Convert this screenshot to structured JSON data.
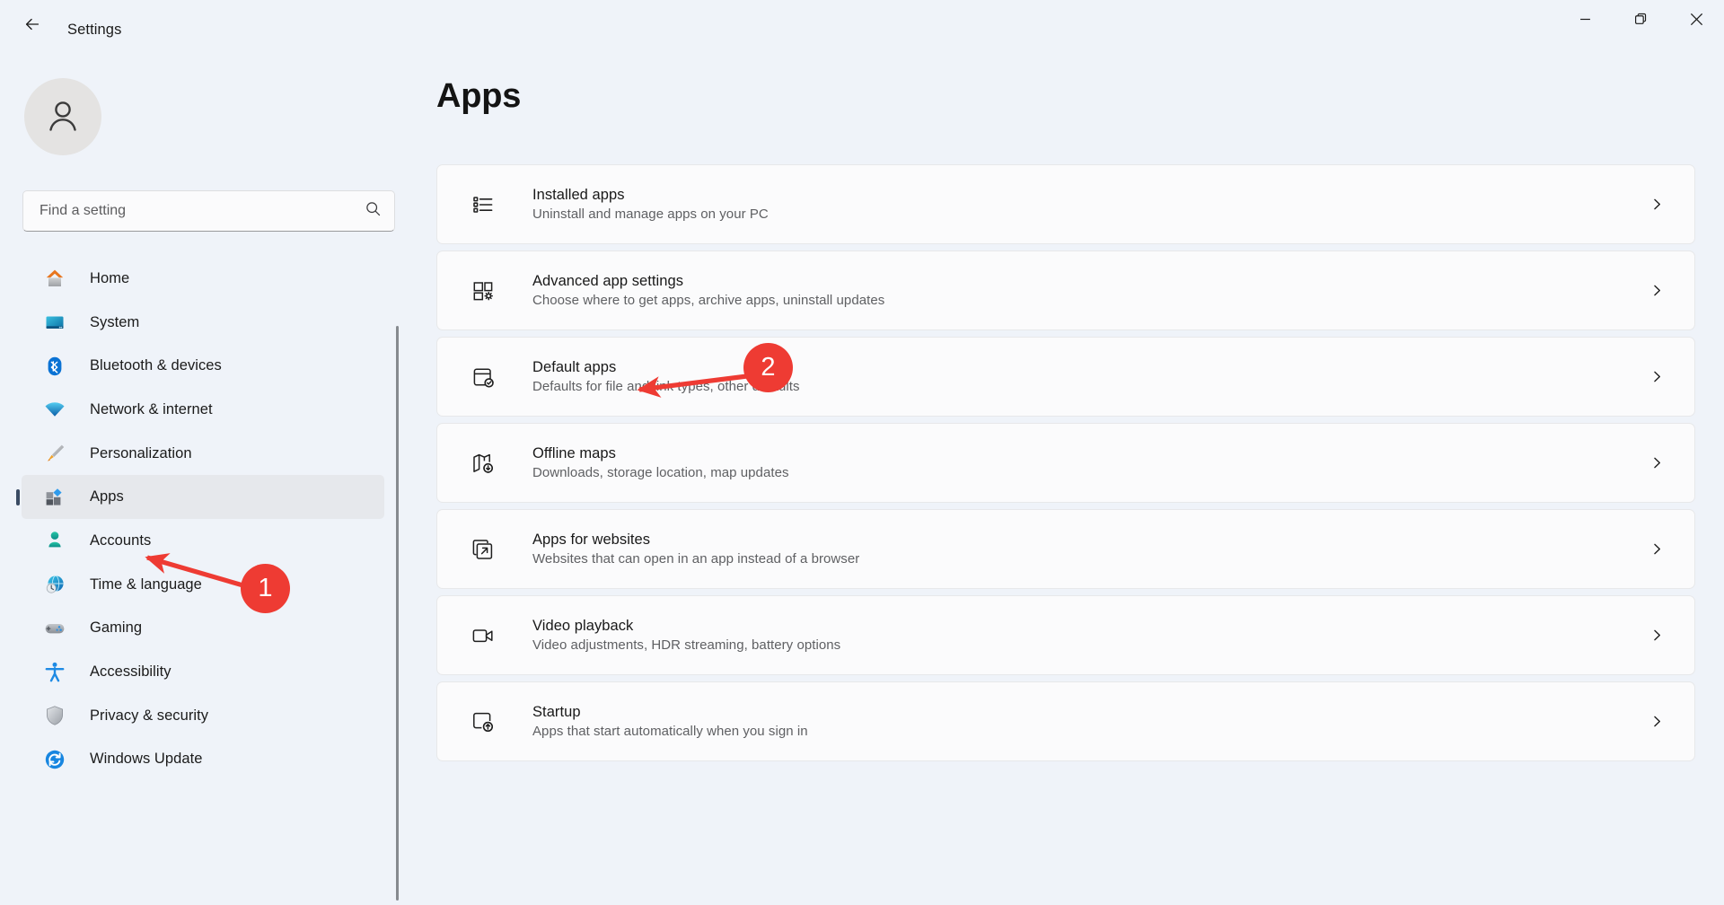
{
  "window": {
    "title": "Settings",
    "back_icon": "arrow-left-icon",
    "controls": [
      {
        "name": "minimize-button",
        "icon": "minimize-icon"
      },
      {
        "name": "maximize-button",
        "icon": "restore-icon"
      },
      {
        "name": "close-button",
        "icon": "close-icon"
      }
    ]
  },
  "sidebar": {
    "avatar_icon": "user-avatar-icon",
    "search": {
      "placeholder": "Find a setting",
      "value": "",
      "icon": "search-icon"
    },
    "items": [
      {
        "label": "Home",
        "icon": "home-icon",
        "selected": false
      },
      {
        "label": "System",
        "icon": "system-icon",
        "selected": false
      },
      {
        "label": "Bluetooth & devices",
        "icon": "bluetooth-icon",
        "selected": false
      },
      {
        "label": "Network & internet",
        "icon": "network-icon",
        "selected": false
      },
      {
        "label": "Personalization",
        "icon": "personalization-icon",
        "selected": false
      },
      {
        "label": "Apps",
        "icon": "apps-icon",
        "selected": true
      },
      {
        "label": "Accounts",
        "icon": "accounts-icon",
        "selected": false
      },
      {
        "label": "Time & language",
        "icon": "time-language-icon",
        "selected": false
      },
      {
        "label": "Gaming",
        "icon": "gaming-icon",
        "selected": false
      },
      {
        "label": "Accessibility",
        "icon": "accessibility-icon",
        "selected": false
      },
      {
        "label": "Privacy & security",
        "icon": "privacy-security-icon",
        "selected": false
      },
      {
        "label": "Windows Update",
        "icon": "windows-update-icon",
        "selected": false
      }
    ]
  },
  "main": {
    "title": "Apps",
    "cards": [
      {
        "title": "Installed apps",
        "subtitle": "Uninstall and manage apps on your PC",
        "icon": "installed-apps-icon"
      },
      {
        "title": "Advanced app settings",
        "subtitle": "Choose where to get apps, archive apps, uninstall updates",
        "icon": "advanced-app-settings-icon"
      },
      {
        "title": "Default apps",
        "subtitle": "Defaults for file and link types, other defaults",
        "icon": "default-apps-icon"
      },
      {
        "title": "Offline maps",
        "subtitle": "Downloads, storage location, map updates",
        "icon": "offline-maps-icon"
      },
      {
        "title": "Apps for websites",
        "subtitle": "Websites that can open in an app instead of a browser",
        "icon": "apps-for-websites-icon"
      },
      {
        "title": "Video playback",
        "subtitle": "Video adjustments, HDR streaming, battery options",
        "icon": "video-playback-icon"
      },
      {
        "title": "Startup",
        "subtitle": "Apps that start automatically when you sign in",
        "icon": "startup-icon"
      }
    ]
  },
  "annotations": {
    "color": "#ee3b33",
    "markers": [
      {
        "label": "1",
        "target": "sidebar-item-apps"
      },
      {
        "label": "2",
        "target": "card-default-apps"
      }
    ]
  }
}
